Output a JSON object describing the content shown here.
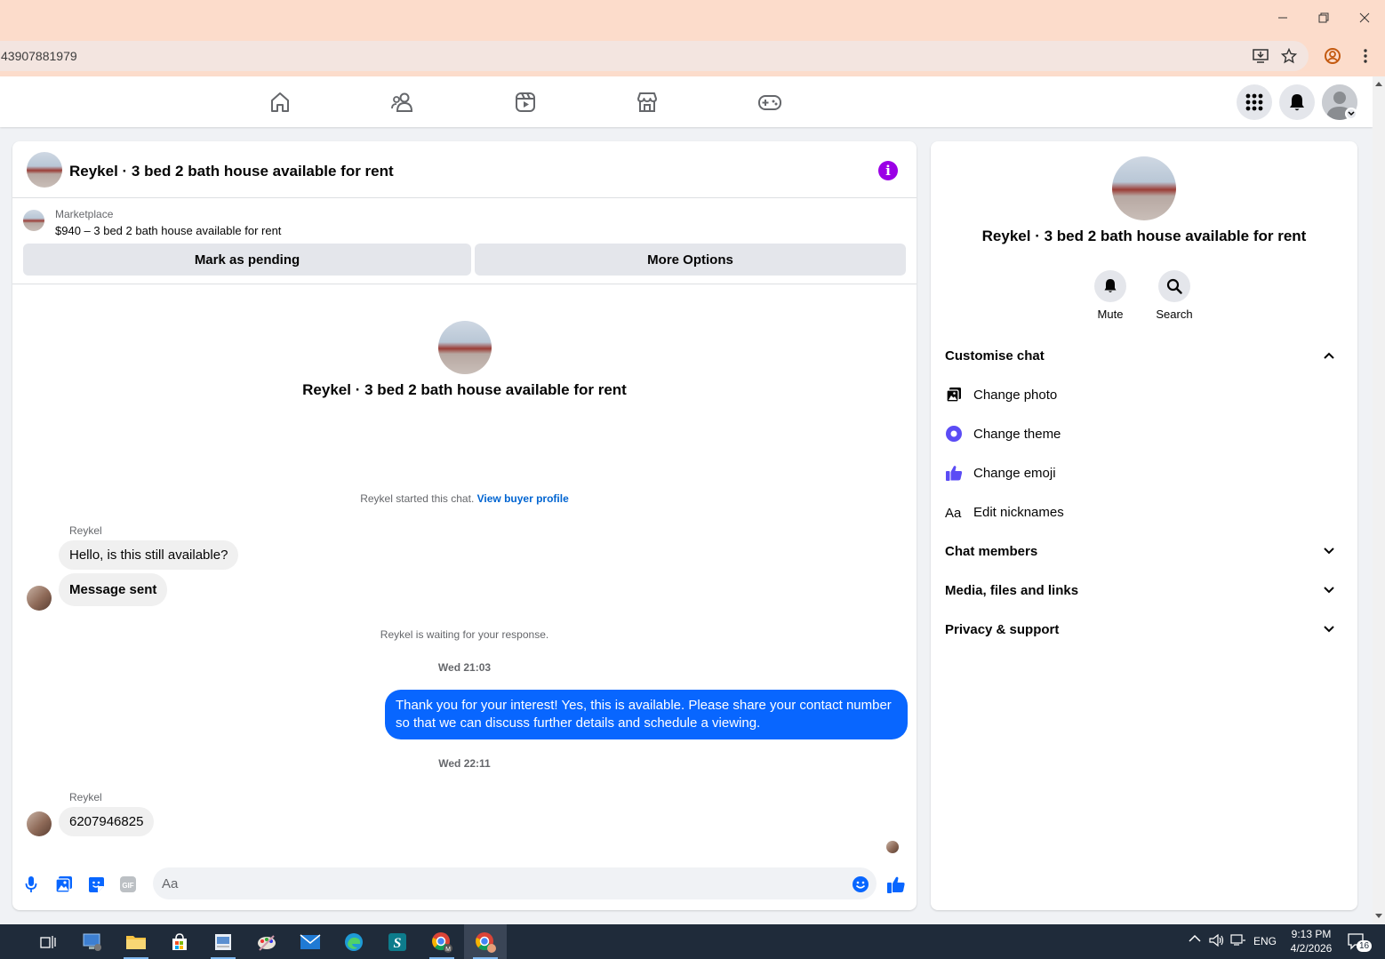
{
  "browser": {
    "url": "43907881979"
  },
  "chat": {
    "header_title": "Reykel · 3 bed 2 bath house available for rent",
    "marketplace_label": "Marketplace",
    "listing_line": "$940 – 3 bed 2 bath house available for rent",
    "mark_pending_label": "Mark as pending",
    "more_options_label": "More Options",
    "center_title": "Reykel · 3 bed 2 bath house available for rent",
    "started_text": "Reykel started this chat.",
    "view_profile_link": "View buyer profile",
    "messages": [
      {
        "sender": "Reykel",
        "text": "Hello, is this still available?"
      },
      {
        "text": "Message sent"
      }
    ],
    "waiting_text": "Reykel is waiting for your response.",
    "timestamp_1": "Wed 21:03",
    "outgoing_text": "Thank you for your interest! Yes, this is available. Please share your contact number so that we can discuss further details and schedule a viewing.",
    "timestamp_2": "Wed 22:11",
    "reply_sender": "Reykel",
    "reply_text": "6207946825",
    "input_placeholder": "Aa"
  },
  "side": {
    "title": "Reykel · 3 bed 2 bath house available for rent",
    "mute_label": "Mute",
    "search_label": "Search",
    "customise_label": "Customise chat",
    "change_photo": "Change photo",
    "change_theme": "Change theme",
    "change_emoji": "Change emoji",
    "edit_nicknames": "Edit nicknames",
    "chat_members": "Chat members",
    "media_files": "Media, files and links",
    "privacy": "Privacy & support"
  },
  "taskbar": {
    "lang": "ENG",
    "time": "9:13 PM",
    "date": "4/2/2026",
    "notif_count": "16"
  },
  "colors": {
    "accent": "#0866ff",
    "theme_purple": "#5b4cf5",
    "info_purple": "#9b00e6",
    "titlebar": "#fcdccb"
  }
}
